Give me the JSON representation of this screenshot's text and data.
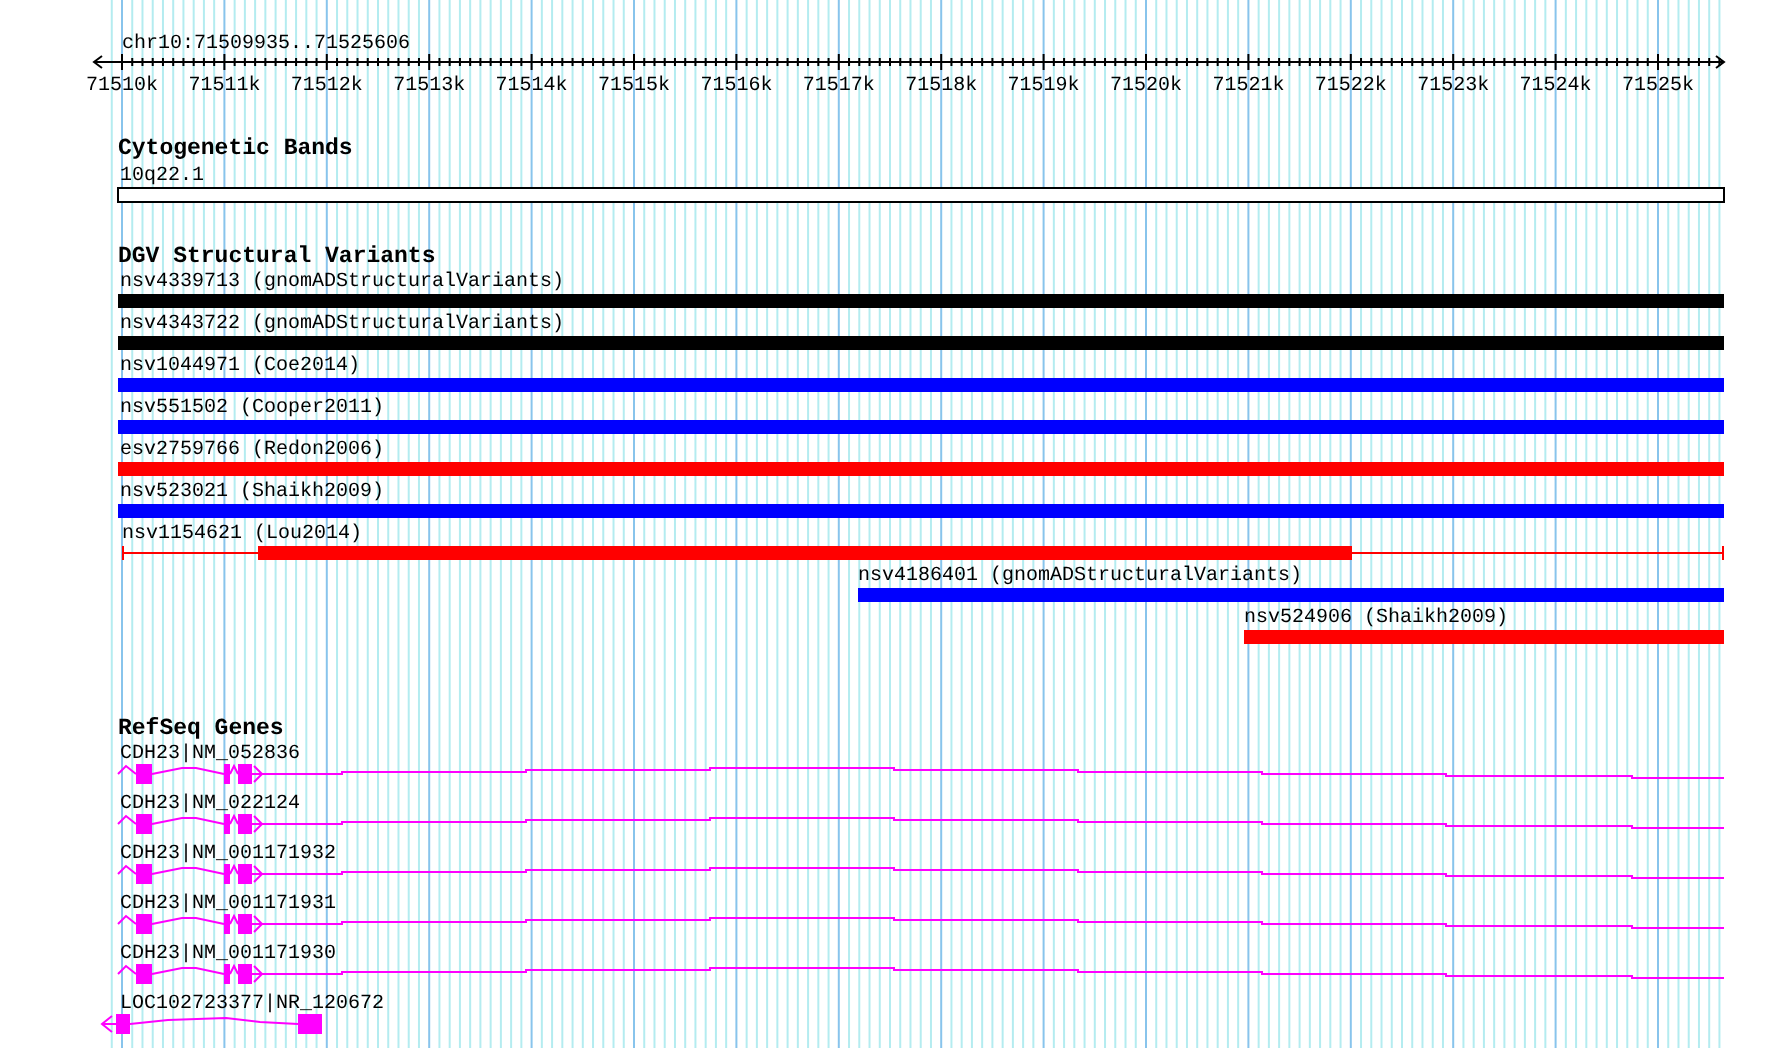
{
  "ruler": {
    "location": "chr10:71509935..71525606",
    "ticks": [
      "71510k",
      "71511k",
      "71512k",
      "71513k",
      "71514k",
      "71515k",
      "71516k",
      "71517k",
      "71518k",
      "71519k",
      "71520k",
      "71521k",
      "71522k",
      "71523k",
      "71524k",
      "71525k"
    ]
  },
  "tracks": [
    {
      "title": "Cytogenetic Bands",
      "kind": "bands",
      "features": [
        {
          "label": "10q22.1"
        }
      ]
    },
    {
      "title": "DGV Structural Variants",
      "kind": "variants",
      "features": [
        {
          "label": "nsv4339713 (gnomADStructuralVariants)",
          "color": "#000000"
        },
        {
          "label": "nsv4343722 (gnomADStructuralVariants)",
          "color": "#000000"
        },
        {
          "label": "nsv1044971 (Coe2014)",
          "color": "#0000ff"
        },
        {
          "label": "nsv551502 (Cooper2011)",
          "color": "#0000ff"
        },
        {
          "label": "esv2759766 (Redon2006)",
          "color": "#ff0000"
        },
        {
          "label": "nsv523021 (Shaikh2009)",
          "color": "#0000ff"
        },
        {
          "label": "nsv1154621 (Lou2014)",
          "color": "#ff0000"
        },
        {
          "label": "nsv4186401 (gnomADStructuralVariants)",
          "color": "#0000ff"
        },
        {
          "label": "nsv524906 (Shaikh2009)",
          "color": "#ff0000"
        }
      ]
    },
    {
      "title": "RefSeq Genes",
      "kind": "genes",
      "features": [
        {
          "label": "CDH23|NM_052836"
        },
        {
          "label": "CDH23|NM_022124"
        },
        {
          "label": "CDH23|NM_001171932"
        },
        {
          "label": "CDH23|NM_001171931"
        },
        {
          "label": "CDH23|NM_001171930"
        },
        {
          "label": "LOC102723377|NR_120672"
        }
      ]
    }
  ]
}
